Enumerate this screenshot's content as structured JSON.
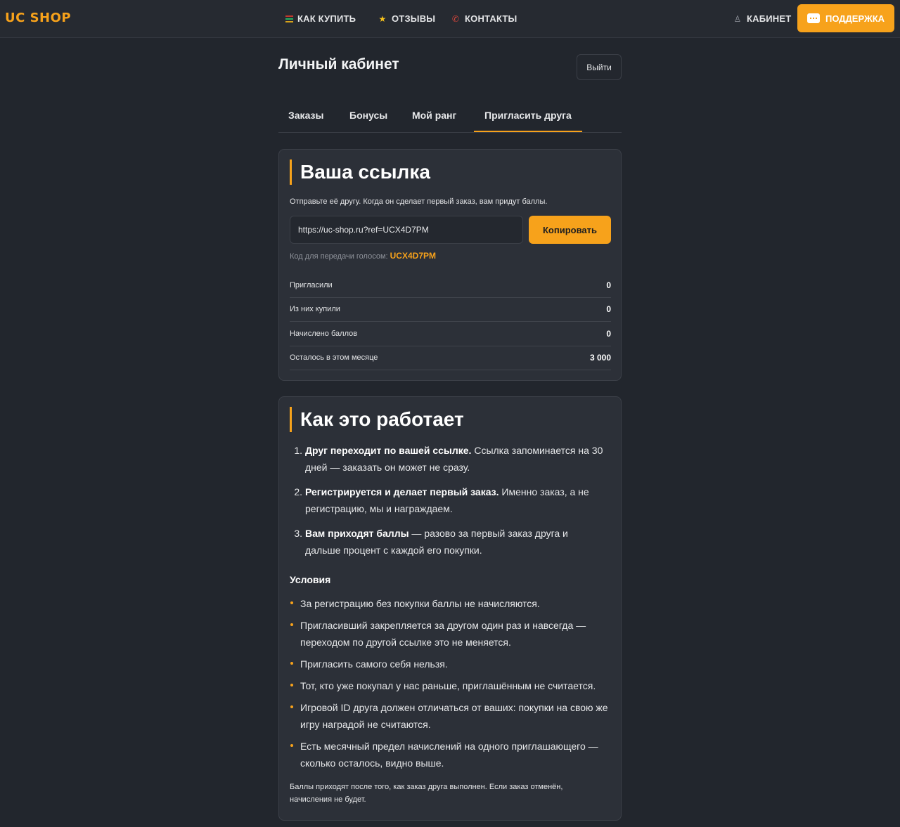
{
  "header": {
    "logo": "UC SHOP",
    "nav": [
      {
        "label": "КАК КУПИТЬ",
        "icon": "book-icon"
      },
      {
        "label": "ОТЗЫВЫ",
        "icon": "star-icon"
      },
      {
        "label": "КОНТАКТЫ",
        "icon": "phone-icon"
      }
    ],
    "cabinet_label": "КАБИНЕТ",
    "support_label": "ПОДДЕРЖКА"
  },
  "page": {
    "title": "Личный кабинет",
    "logout_label": "Выйти"
  },
  "tabs": [
    {
      "label": "Заказы",
      "active": false
    },
    {
      "label": "Бонусы",
      "active": false
    },
    {
      "label": "Мой ранг",
      "active": false
    },
    {
      "label": "Пригласить друга",
      "active": true
    }
  ],
  "link_card": {
    "title": "Ваша ссылка",
    "description": "Отправьте её другу. Когда он сделает первый заказ, вам придут баллы.",
    "link_value": "https://uc-shop.ru?ref=UCX4D7PM",
    "copy_label": "Копировать",
    "voice_label": "Код для передачи голосом:",
    "voice_code": "UCX4D7PM",
    "stats": [
      {
        "label": "Пригласили",
        "value": "0"
      },
      {
        "label": "Из них купили",
        "value": "0"
      },
      {
        "label": "Начислено баллов",
        "value": "0"
      },
      {
        "label": "Осталось в этом месяце",
        "value": "3 000"
      }
    ]
  },
  "how_card": {
    "title": "Как это работает",
    "steps": [
      {
        "num": "1.",
        "bold": "Друг переходит по вашей ссылке.",
        "text": " Ссылка запоминается на 30 дней — заказать он может не сразу."
      },
      {
        "num": "2.",
        "bold": "Регистрируется и делает первый заказ.",
        "text": " Именно заказ, а не регистрацию, мы и награждаем."
      },
      {
        "num": "3.",
        "bold": "Вам приходят баллы",
        "text": " — разово за первый заказ друга и дальше процент с каждой его покупки."
      }
    ],
    "conditions_title": "Условия",
    "conditions": [
      "За регистрацию без покупки баллы не начисляются.",
      "Пригласивший закрепляется за другом один раз и навсегда — переходом по другой ссылке это не меняется.",
      "Пригласить самого себя нельзя.",
      "Тот, кто уже покупал у нас раньше, приглашённым не считается.",
      "Игровой ID друга должен отличаться от ваших: покупки на свою же игру наградой не считаются.",
      "Есть месячный предел начислений на одного приглашающего — сколько осталось, видно выше."
    ],
    "footnote": "Баллы приходят после того, как заказ друга выполнен. Если заказ отменён, начисления не будет."
  }
}
